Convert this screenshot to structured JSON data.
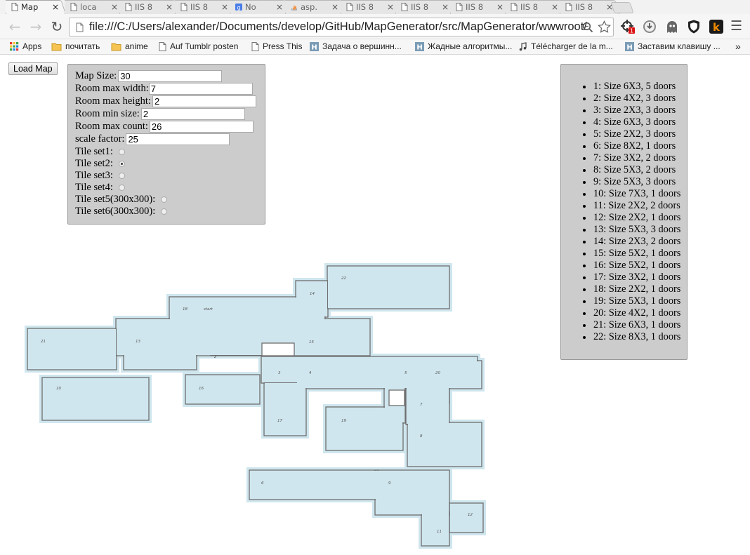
{
  "browser": {
    "tabs": [
      {
        "label": "Map",
        "icon": "page-icon",
        "active": true
      },
      {
        "label": "loca",
        "icon": "page-icon"
      },
      {
        "label": "IIS 8",
        "icon": "page-icon"
      },
      {
        "label": "IIS 8",
        "icon": "page-icon"
      },
      {
        "label": "No",
        "icon": "google-icon"
      },
      {
        "label": "asp.",
        "icon": "stackoverflow-icon"
      },
      {
        "label": "IIS 8",
        "icon": "page-icon"
      },
      {
        "label": "IIS 8",
        "icon": "page-icon"
      },
      {
        "label": "IIS 8",
        "icon": "page-icon"
      },
      {
        "label": "IIS 8",
        "icon": "page-icon"
      },
      {
        "label": "IIS 8",
        "icon": "page-icon"
      }
    ],
    "url": "file:///C:/Users/alexander/Documents/develop/GitHub/MapGenerator/src/MapGenerator/wwwroot/",
    "bookmarks": [
      {
        "label": "Apps",
        "icon": "apps-grid-icon"
      },
      {
        "label": "почитать",
        "icon": "folder-icon"
      },
      {
        "label": "anime",
        "icon": "folder-icon"
      },
      {
        "label": "Auf Tumblr posten",
        "icon": "page-icon"
      },
      {
        "label": "Press This",
        "icon": "page-icon"
      },
      {
        "label": "Задача о вершинн...",
        "icon": "habr-icon"
      },
      {
        "label": "Жадные алгоритмы...",
        "icon": "habr-icon"
      },
      {
        "label": "Télécharger de la m...",
        "icon": "music-icon"
      },
      {
        "label": "Заставим клавишу ...",
        "icon": "habr-icon"
      }
    ],
    "bookmarks_overflow": "»",
    "close_glyph": "×"
  },
  "page": {
    "load_button": "Load Map",
    "settings": {
      "map_size_label": "Map Size:",
      "map_size_value": "30",
      "room_max_width_label": "Room max width:",
      "room_max_width_value": "7",
      "room_max_height_label": "Room max height:",
      "room_max_height_value": "2",
      "room_min_size_label": "Room min size:",
      "room_min_size_value": "2",
      "room_max_count_label": "Room max count:",
      "room_max_count_value": "26",
      "scale_factor_label": "scale factor:",
      "scale_factor_value": "25",
      "tile_sets": [
        {
          "label": "Tile set1:",
          "checked": false
        },
        {
          "label": "Tile set2:",
          "checked": true
        },
        {
          "label": "Tile set3:",
          "checked": false
        },
        {
          "label": "Tile set4:",
          "checked": false
        },
        {
          "label": "Tile set5(300x300):",
          "checked": false
        },
        {
          "label": "Tile set6(300x300):",
          "checked": false
        }
      ]
    },
    "rooms": [
      "1: Size 6X3, 5 doors",
      "2: Size 4X2, 3 doors",
      "3: Size 2X3, 3 doors",
      "4: Size 6X3, 3 doors",
      "5: Size 2X2, 3 doors",
      "6: Size 8X2, 1 doors",
      "7: Size 3X2, 2 doors",
      "8: Size 5X3, 2 doors",
      "9: Size 5X3, 3 doors",
      "10: Size 7X3, 1 doors",
      "11: Size 2X2, 2 doors",
      "12: Size 2X2, 1 doors",
      "13: Size 5X3, 3 doors",
      "14: Size 2X3, 2 doors",
      "15: Size 5X2, 1 doors",
      "16: Size 5X2, 1 doors",
      "17: Size 3X2, 1 doors",
      "18: Size 2X2, 1 doors",
      "19: Size 5X3, 1 doors",
      "20: Size 4X2, 1 doors",
      "21: Size 6X3, 1 doors",
      "22: Size 8X3, 1 doors"
    ],
    "map_labels": [
      "22",
      "14",
      "18",
      "start",
      "21",
      "13",
      "15",
      "2",
      "3",
      "4",
      "5",
      "20",
      "10",
      "16",
      "7",
      "17",
      "19",
      "8",
      "6",
      "9",
      "12",
      "11"
    ],
    "colors": {
      "floor": "#cfe6ee",
      "wall": "#6e6e6e",
      "panel": "#cccccc"
    }
  }
}
